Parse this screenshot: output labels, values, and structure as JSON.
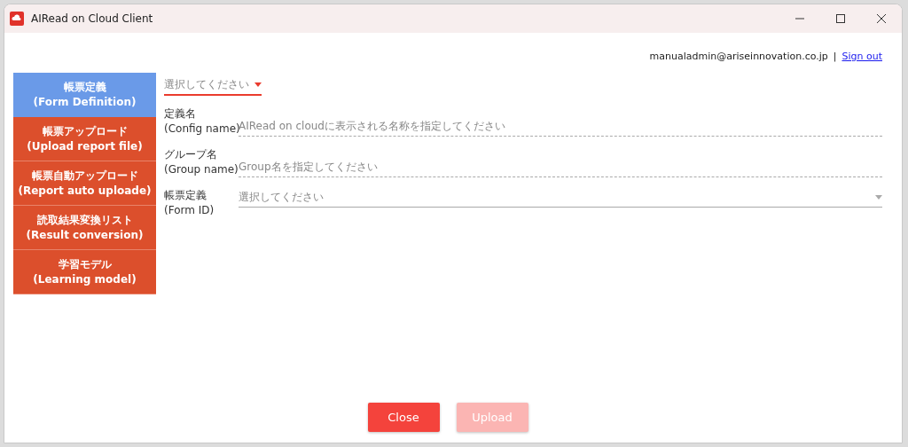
{
  "window": {
    "title": "AIRead on Cloud Client"
  },
  "user": {
    "email": "manualadmin@ariseinnovation.co.jp",
    "separator": "|",
    "sign_out": "Sign out"
  },
  "sidebar": {
    "items": [
      {
        "label": "帳票定義",
        "sublabel": "(Form Definition)",
        "selected": true
      },
      {
        "label": "帳票アップロード",
        "sublabel": "(Upload report file)",
        "selected": false
      },
      {
        "label": "帳票自動アップロード",
        "sublabel": "(Report auto uploade)",
        "selected": false
      },
      {
        "label": "読取結果変換リスト",
        "sublabel": "(Result conversion)",
        "selected": false
      },
      {
        "label": "学習モデル",
        "sublabel": "(Learning model)",
        "selected": false
      }
    ]
  },
  "config_select": {
    "placeholder": "選択してください"
  },
  "fields": [
    {
      "kind": "text",
      "label": "定義名",
      "sublabel": "(Config name)",
      "placeholder": "AIRead on cloudに表示される名称を指定してください"
    },
    {
      "kind": "text",
      "label": "グループ名",
      "sublabel": "(Group name)",
      "placeholder": "Group名を指定してください"
    },
    {
      "kind": "select",
      "label": "帳票定義",
      "sublabel": "(Form ID)",
      "placeholder": "選択してください"
    }
  ],
  "buttons": [
    {
      "label": "Close",
      "disabled": false
    },
    {
      "label": "Upload",
      "disabled": true
    }
  ]
}
